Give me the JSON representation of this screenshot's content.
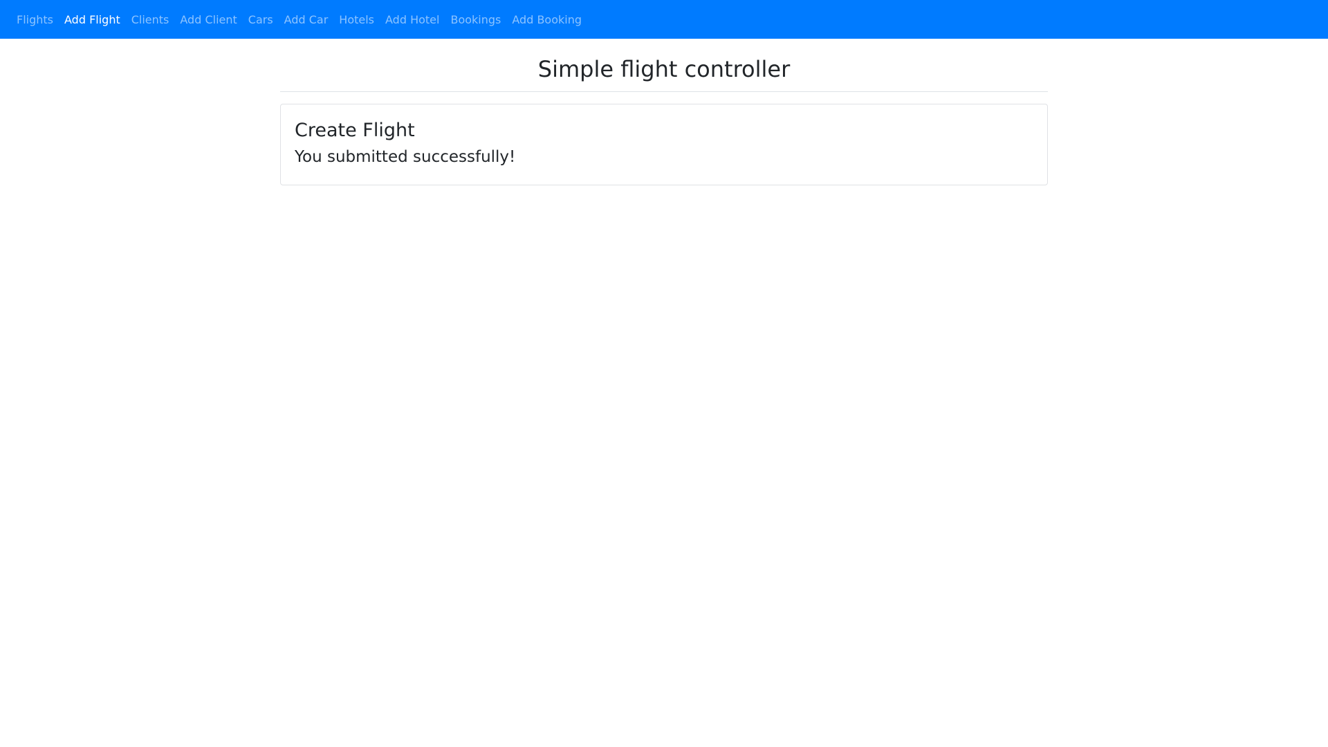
{
  "nav": {
    "items": [
      {
        "label": "Flights",
        "active": false
      },
      {
        "label": "Add Flight",
        "active": true
      },
      {
        "label": "Clients",
        "active": false
      },
      {
        "label": "Add Client",
        "active": false
      },
      {
        "label": "Cars",
        "active": false
      },
      {
        "label": "Add Car",
        "active": false
      },
      {
        "label": "Hotels",
        "active": false
      },
      {
        "label": "Add Hotel",
        "active": false
      },
      {
        "label": "Bookings",
        "active": false
      },
      {
        "label": "Add Booking",
        "active": false
      }
    ]
  },
  "page": {
    "title": "Simple flight controller"
  },
  "card": {
    "title": "Create Flight",
    "message": "You submitted successfully!"
  },
  "colors": {
    "navbar": "#007bff",
    "nav_link": "rgba(255,255,255,0.55)",
    "nav_link_active": "#ffffff",
    "text": "#212529"
  }
}
